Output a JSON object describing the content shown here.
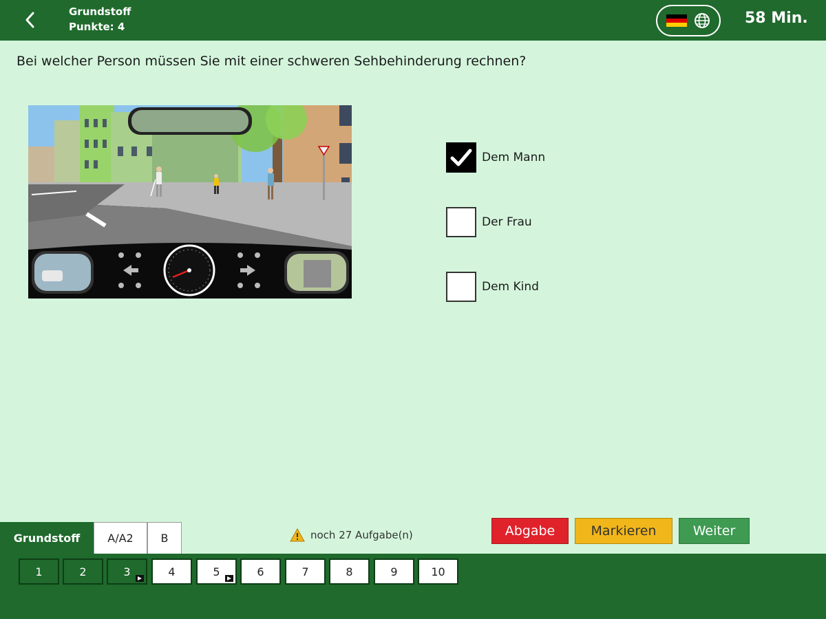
{
  "header": {
    "category": "Grundstoff",
    "points": "Punkte: 4",
    "timer": "58 Min."
  },
  "question": {
    "text": "Bei welcher Person müssen Sie mit einer schweren Sehbehinderung rechnen?"
  },
  "answers": [
    {
      "label": "Dem Mann",
      "checked": true
    },
    {
      "label": "Der Frau",
      "checked": false
    },
    {
      "label": "Dem Kind",
      "checked": false
    }
  ],
  "tabs": [
    {
      "label": "Grundstoff",
      "active": true
    },
    {
      "label": "A/A2",
      "active": false
    },
    {
      "label": "B",
      "active": false
    }
  ],
  "remaining": "noch 27 Aufgabe(n)",
  "buttons": {
    "submit": "Abgabe",
    "mark": "Markieren",
    "next": "Weiter"
  },
  "question_numbers": [
    {
      "label": "1",
      "state": "done"
    },
    {
      "label": "2",
      "state": "done"
    },
    {
      "label": "3",
      "state": "done",
      "marked": true
    },
    {
      "label": "4",
      "state": "todo"
    },
    {
      "label": "5",
      "state": "todo",
      "marked": true
    },
    {
      "label": "6",
      "state": "todo"
    },
    {
      "label": "7",
      "state": "todo"
    },
    {
      "label": "8",
      "state": "todo"
    },
    {
      "label": "9",
      "state": "todo"
    },
    {
      "label": "10",
      "state": "todo"
    }
  ],
  "colors": {
    "header_green": "#1f6a2c",
    "background": "#d4f5dc",
    "submit_red": "#e0222b",
    "mark_yellow": "#f1b619",
    "next_green": "#3f9a52"
  },
  "icons": {
    "back": "chevron-left-icon",
    "flag": "german-flag-icon",
    "globe": "globe-icon",
    "warning": "warning-icon",
    "check": "checkmark-icon",
    "marked": "play-marker-icon"
  }
}
